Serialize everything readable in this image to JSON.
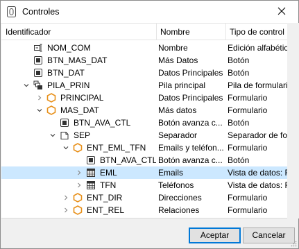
{
  "window": {
    "title": "Controles",
    "close_glyph": "✕"
  },
  "columns": [
    "Identificador",
    "Nombre",
    "Tipo de control"
  ],
  "rows": [
    {
      "id": "NOM_COM",
      "name": "Nombre",
      "type": "Edición alfabética",
      "depth": 2,
      "icon": "edit-field-icon",
      "expander": "none"
    },
    {
      "id": "BTN_MAS_DAT",
      "name": "Más Datos",
      "type": "Botón",
      "depth": 2,
      "icon": "button-icon",
      "expander": "none"
    },
    {
      "id": "BTN_DAT",
      "name": "Datos Principales",
      "type": "Botón",
      "depth": 2,
      "icon": "button-icon",
      "expander": "none"
    },
    {
      "id": "PILA_PRIN",
      "name": "Pila principal",
      "type": "Pila de formularios",
      "depth": 2,
      "icon": "stack-icon",
      "expander": "expanded"
    },
    {
      "id": "PRINCIPAL",
      "name": "Datos Principales",
      "type": "Formulario",
      "depth": 3,
      "icon": "form-icon",
      "expander": "collapsed"
    },
    {
      "id": "MAS_DAT",
      "name": "Más datos",
      "type": "Formulario",
      "depth": 3,
      "icon": "form-icon",
      "expander": "expanded"
    },
    {
      "id": "BTN_AVA_CTL",
      "name": "Botón avanza c...",
      "type": "Botón",
      "depth": 4,
      "icon": "button-icon",
      "expander": "none"
    },
    {
      "id": "SEP",
      "name": "Separador",
      "type": "Separador de fo...",
      "depth": 4,
      "icon": "separator-icon",
      "expander": "expanded"
    },
    {
      "id": "ENT_EML_TFN",
      "name": "Emails y teléfon...",
      "type": "Formulario",
      "depth": 5,
      "icon": "form-icon",
      "expander": "expanded"
    },
    {
      "id": "BTN_AVA_CTL",
      "name": "Botón avanza c...",
      "type": "Botón",
      "depth": 6,
      "icon": "button-icon",
      "expander": "none"
    },
    {
      "id": "EML",
      "name": "Emails",
      "type": "Vista de datos: R",
      "depth": 6,
      "icon": "grid-icon",
      "expander": "collapsed",
      "selected": true
    },
    {
      "id": "TFN",
      "name": "Teléfonos",
      "type": "Vista de datos: R",
      "depth": 6,
      "icon": "grid-icon",
      "expander": "collapsed"
    },
    {
      "id": "ENT_DIR",
      "name": "Direcciones",
      "type": "Formulario",
      "depth": 5,
      "icon": "form-icon",
      "expander": "collapsed"
    },
    {
      "id": "ENT_REL",
      "name": "Relaciones",
      "type": "Formulario",
      "depth": 5,
      "icon": "form-icon",
      "expander": "collapsed"
    }
  ],
  "buttons": {
    "accept": "Aceptar",
    "cancel": "Cancelar"
  },
  "colors": {
    "selection": "#cce8ff",
    "form_icon": "#e8901a",
    "accent": "#0078d7"
  }
}
